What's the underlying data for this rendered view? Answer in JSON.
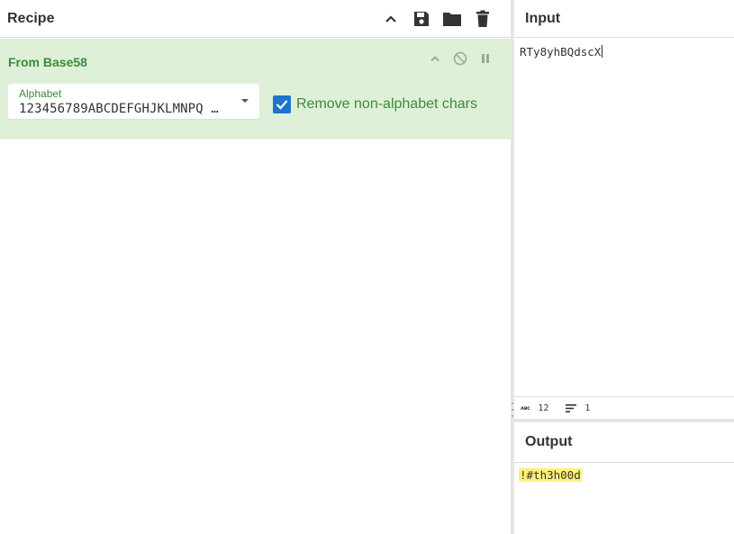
{
  "recipe": {
    "title": "Recipe",
    "operation": {
      "name": "From Base58",
      "alphabet_label": "Alphabet",
      "alphabet_value": "123456789ABCDEFGHJKLMNPQ …",
      "checkbox_label": "Remove non-alphabet chars",
      "checkbox_checked": true
    }
  },
  "input": {
    "title": "Input",
    "text": "RTy8yhBQdscX",
    "stats": {
      "length": "12",
      "lines": "1"
    }
  },
  "output": {
    "title": "Output",
    "text": "!#th3h00d"
  },
  "colors": {
    "operation_bg": "#dff0d8",
    "operation_text": "#3c8a3c",
    "checkbox": "#1c73d0",
    "output_highlight": "#fff176"
  }
}
